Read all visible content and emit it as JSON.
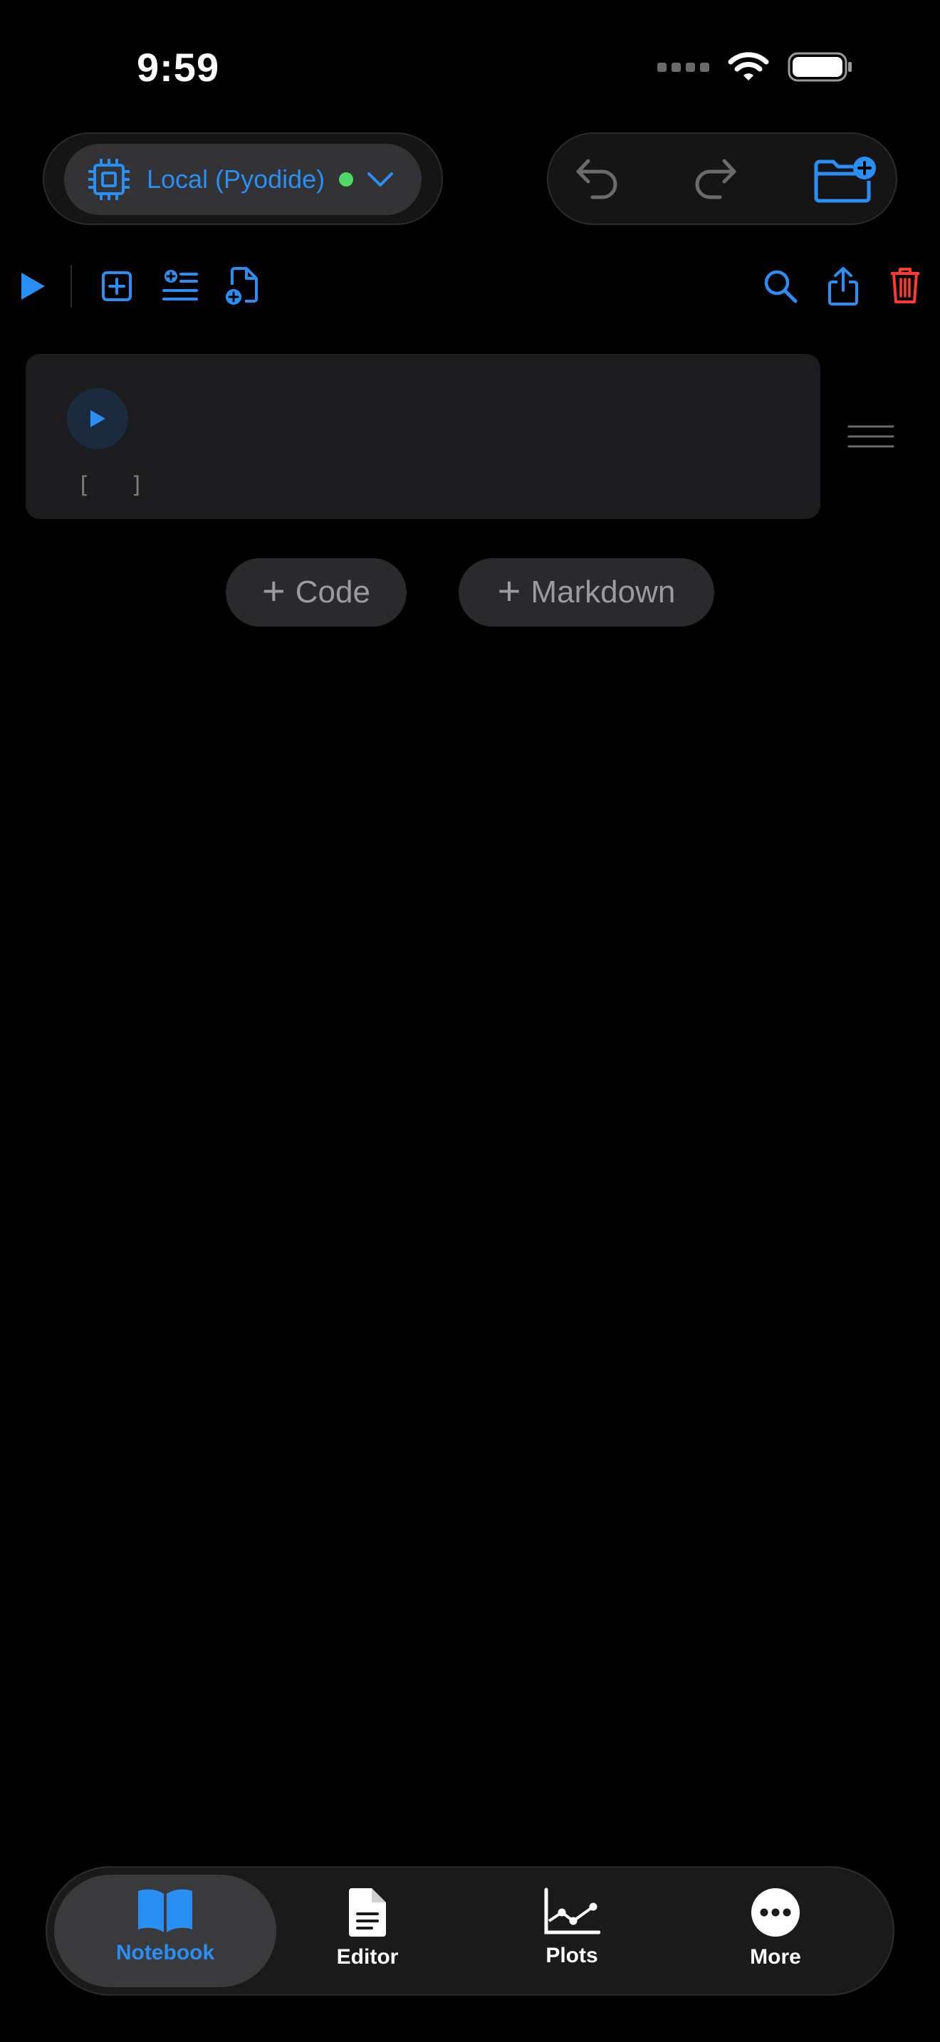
{
  "status_bar": {
    "time": "9:59"
  },
  "kernel": {
    "label": "Local (Pyodide)",
    "status_color": "#4cd964",
    "icon": "cpu-icon"
  },
  "toolbar": {
    "left_icons": [
      "play-icon",
      "add-cell-icon",
      "insert-list-icon",
      "new-document-icon"
    ],
    "right_icons": [
      "search-icon",
      "share-icon",
      "trash-icon"
    ],
    "accent": "#2a8ff5",
    "danger": "#ff3b30"
  },
  "cell": {
    "execution_count": "[ ]"
  },
  "add_buttons": {
    "code": "Code",
    "markdown": "Markdown",
    "plus": "+"
  },
  "tabs": [
    {
      "label": "Notebook",
      "icon": "book-icon",
      "active": true
    },
    {
      "label": "Editor",
      "icon": "document-icon",
      "active": false
    },
    {
      "label": "Plots",
      "icon": "chart-line-icon",
      "active": false
    },
    {
      "label": "More",
      "icon": "ellipsis-circle-icon",
      "active": false
    }
  ]
}
